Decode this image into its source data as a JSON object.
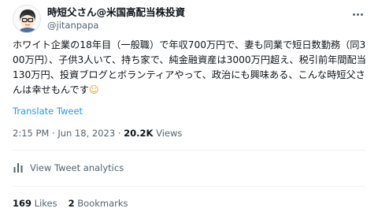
{
  "author": {
    "display_name": "時短父さん@米国高配当株投資",
    "handle": "@jitanpapa"
  },
  "tweet": {
    "text": "ホワイト企業の18年目（一般職）で年収700万円で、妻も同業で短日数勤務（同300万円）、子供3人いて、持ち家で、純金融資産は3000万円超え、税引前年間配当130万円、投資ブログとボランティアやって、政治にも興味ある、こんな時短父さんは幸せもんです",
    "emoji": "☺",
    "translate_label": "Translate Tweet"
  },
  "meta": {
    "time": "2:15 PM",
    "separator1": " · ",
    "date": "Jun 18, 2023",
    "separator2": " · ",
    "views_count": "20.2K",
    "views_label": " Views"
  },
  "analytics": {
    "label": "View Tweet analytics"
  },
  "stats": {
    "likes_count": "169",
    "likes_label": " Likes",
    "bookmarks_count": "2",
    "bookmarks_label": " Bookmarks"
  },
  "icons": [
    "avatar-cartoon",
    "more-icon",
    "analytics-icon"
  ],
  "colors": {
    "link": "#1d9bf0",
    "secondary_text": "#536471",
    "primary_text": "#0f1419",
    "divider": "#eff3f4"
  }
}
